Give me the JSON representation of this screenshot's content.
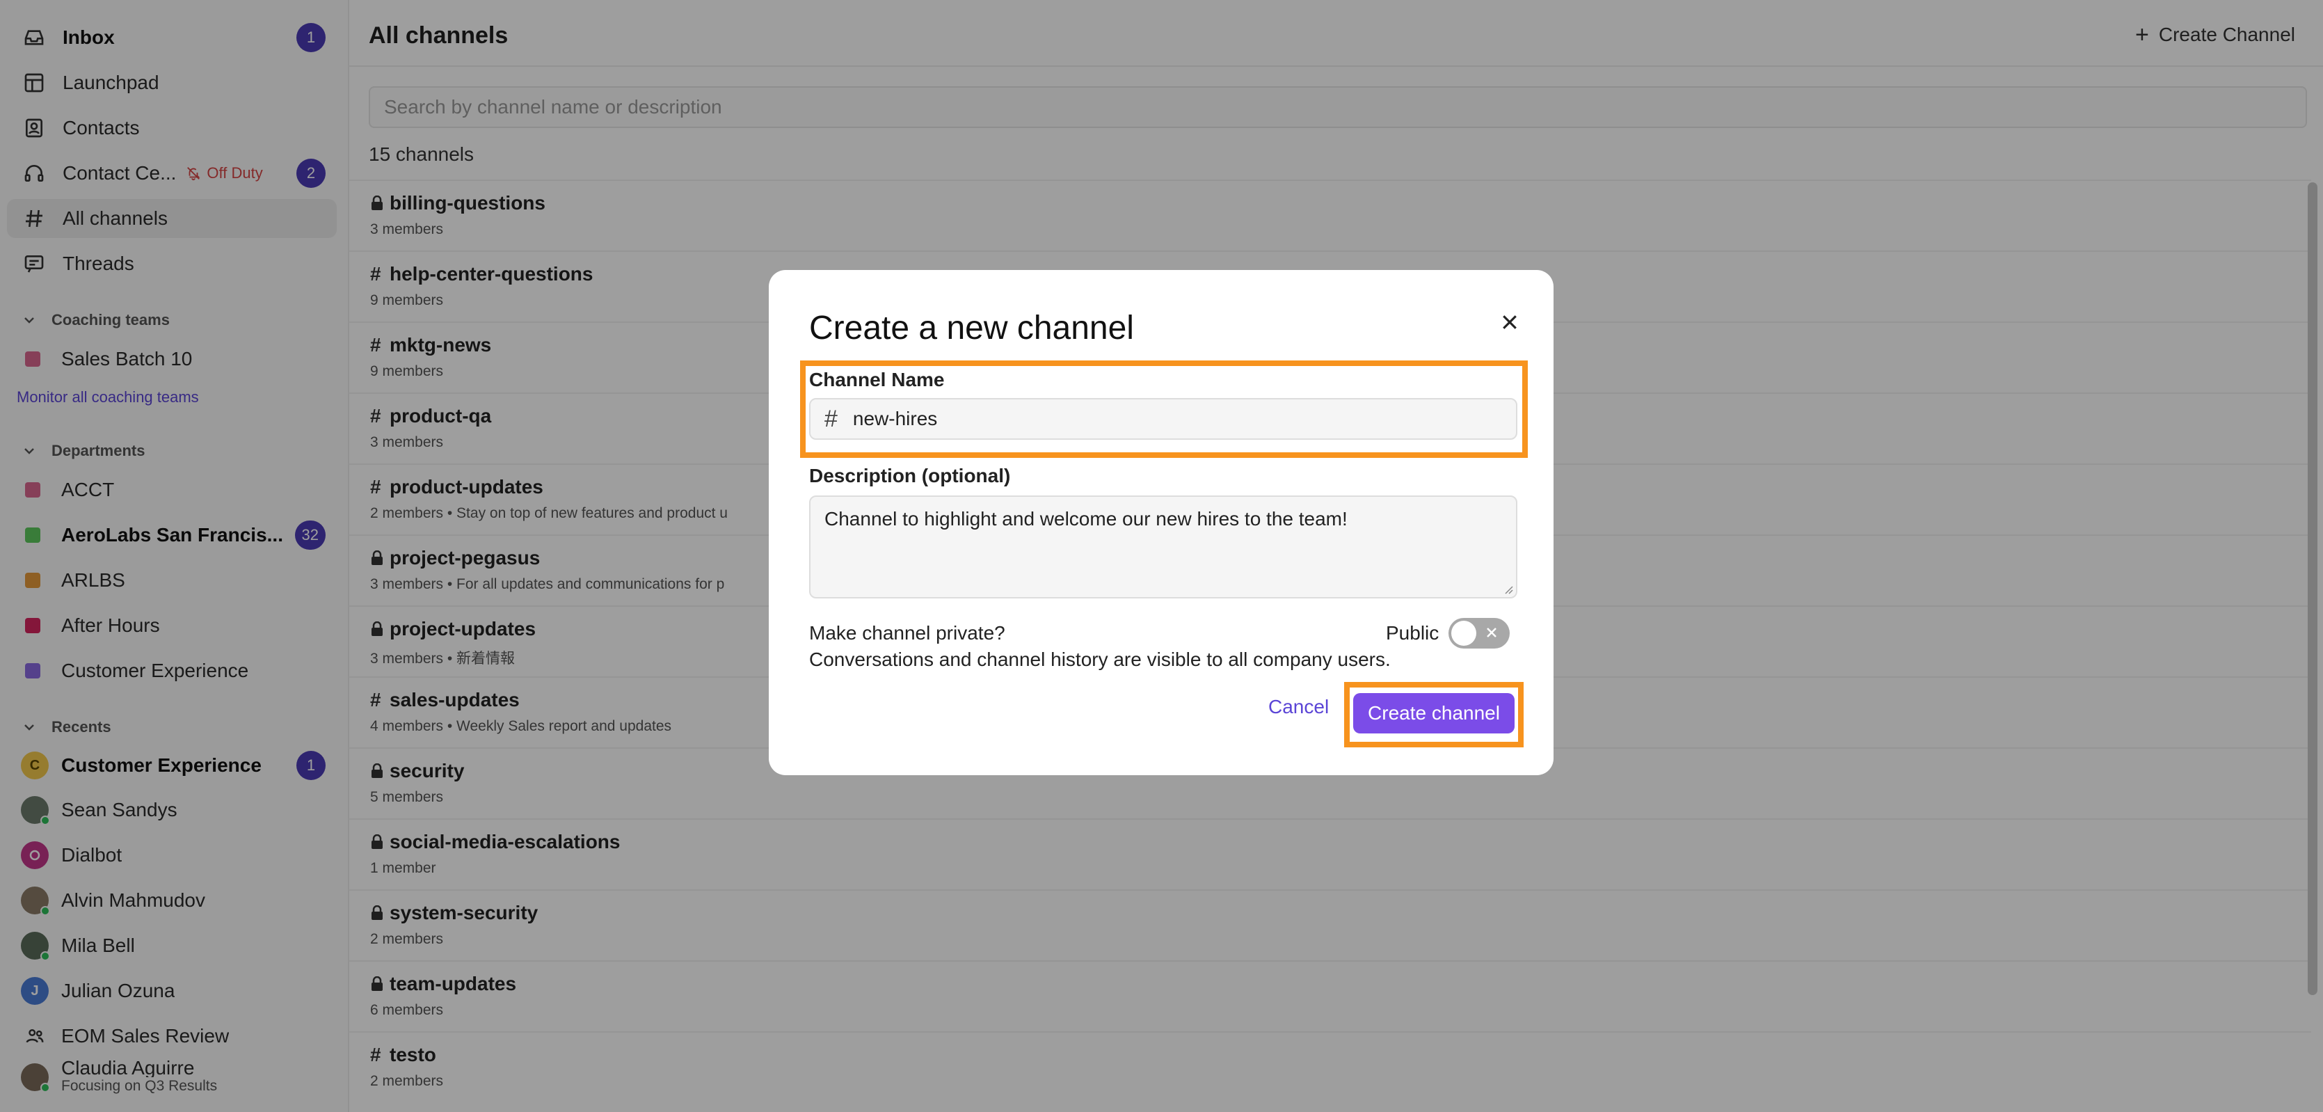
{
  "sidebar": {
    "nav": [
      {
        "label": "Inbox",
        "icon": "inbox-icon",
        "badge": "1",
        "bold": true
      },
      {
        "label": "Launchpad",
        "icon": "launchpad-icon"
      },
      {
        "label": "Contacts",
        "icon": "contacts-icon"
      },
      {
        "label": "Contact Ce...",
        "icon": "headset-icon",
        "status": "Off Duty",
        "badge": "2"
      },
      {
        "label": "All channels",
        "icon": "hash-icon",
        "active": true
      },
      {
        "label": "Threads",
        "icon": "threads-icon"
      }
    ],
    "coaching": {
      "header": "Coaching teams",
      "items": [
        {
          "label": "Sales Batch 10",
          "color": "#d9668f"
        }
      ],
      "monitor_link": "Monitor all coaching teams"
    },
    "departments": {
      "header": "Departments",
      "items": [
        {
          "label": "ACCT",
          "color": "#d9668f"
        },
        {
          "label": "AeroLabs San Francis...",
          "color": "#5cc85c",
          "badge": "32",
          "bold": true
        },
        {
          "label": "ARLBS",
          "color": "#e69a3a"
        },
        {
          "label": "After Hours",
          "color": "#d6245e"
        },
        {
          "label": "Customer Experience",
          "color": "#8a6ae0"
        }
      ]
    },
    "recents": {
      "header": "Recents",
      "items": [
        {
          "label": "Customer Experience",
          "avatar": "C",
          "avatar_color": "#f2c94c",
          "badge": "1",
          "bold": true
        },
        {
          "label": "Sean Sandys",
          "avatar_color": "#6b7a6b",
          "presence": true
        },
        {
          "label": "Dialbot",
          "avatar_color": "#c2368a"
        },
        {
          "label": "Alvin Mahmudov",
          "avatar_color": "#8a7a66",
          "presence": true
        },
        {
          "label": "Mila Bell",
          "avatar_color": "#5a6b5a",
          "presence": true
        },
        {
          "label": "Julian Ozuna",
          "avatar": "J",
          "avatar_color": "#4a7bd6"
        },
        {
          "label": "EOM Sales Review",
          "icon": "group-icon"
        },
        {
          "label": "Claudia Aguirre",
          "sub": "Focusing on Q3 Results",
          "avatar_color": "#7a6a5a",
          "presence": true
        }
      ]
    }
  },
  "main": {
    "title": "All channels",
    "create_label": "Create Channel",
    "search_placeholder": "Search by channel name or description",
    "count": "15 channels",
    "channels": [
      {
        "name": "billing-questions",
        "private": true,
        "meta": "3 members"
      },
      {
        "name": "help-center-questions",
        "private": false,
        "meta": "9 members"
      },
      {
        "name": "mktg-news",
        "private": false,
        "meta": "9 members"
      },
      {
        "name": "product-qa",
        "private": false,
        "meta": "3 members"
      },
      {
        "name": "product-updates",
        "private": false,
        "meta": "2 members  •  Stay on top of new features and product u"
      },
      {
        "name": "project-pegasus",
        "private": true,
        "meta": "3 members  •  For all updates and communications for p"
      },
      {
        "name": "project-updates",
        "private": true,
        "meta": "3 members  •  新着情報"
      },
      {
        "name": "sales-updates",
        "private": false,
        "meta": "4 members  •  Weekly Sales report and updates"
      },
      {
        "name": "security",
        "private": true,
        "meta": "5 members"
      },
      {
        "name": "social-media-escalations",
        "private": true,
        "meta": "1 member"
      },
      {
        "name": "system-security",
        "private": true,
        "meta": "2 members"
      },
      {
        "name": "team-updates",
        "private": true,
        "meta": "6 members"
      },
      {
        "name": "testo",
        "private": false,
        "meta": "2 members"
      }
    ]
  },
  "modal": {
    "title": "Create a new channel",
    "name_label": "Channel Name",
    "name_value": "new-hires",
    "desc_label": "Description (optional)",
    "desc_value": "Channel to highlight and welcome our new hires to the team!",
    "private_question": "Make channel private?",
    "private_desc": "Conversations and channel history are visible to all company users.",
    "toggle_label": "Public",
    "cancel_label": "Cancel",
    "submit_label": "Create channel",
    "accent": "#7b4ce8",
    "highlight": "#f7931e"
  }
}
